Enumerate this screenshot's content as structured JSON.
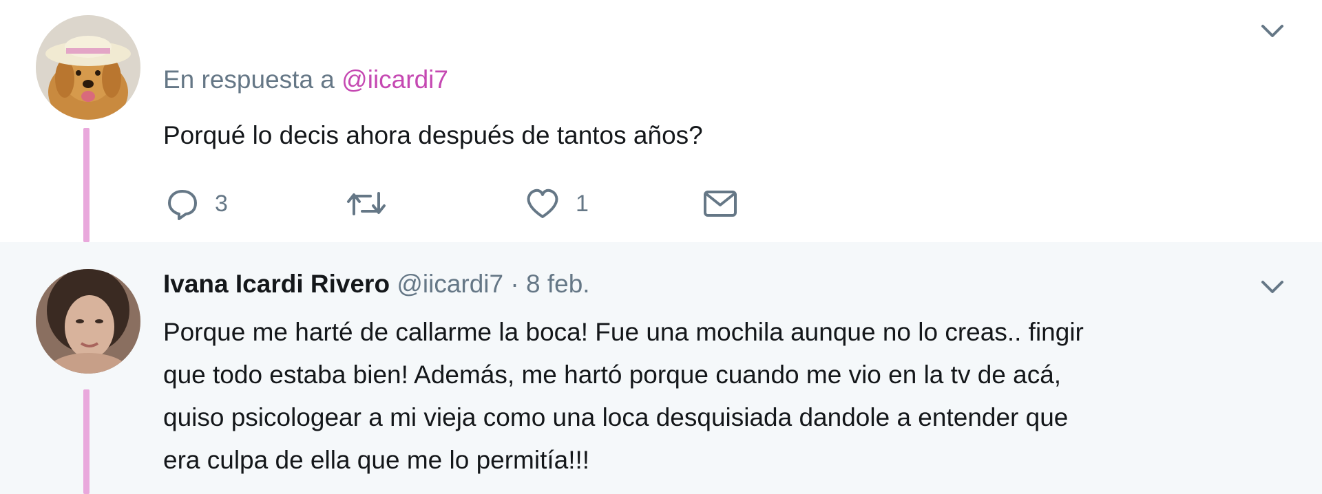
{
  "tweet1": {
    "reply_prefix": "En respuesta a",
    "reply_mention": "@iicardi7",
    "text": "Porqué lo decis ahora después de tantos años?",
    "actions": {
      "reply_count": "3",
      "retweet_count": "",
      "like_count": "1"
    }
  },
  "tweet2": {
    "name": "Ivana Icardi Rivero",
    "handle": "@iicardi7",
    "separator": "·",
    "date": "8 feb.",
    "lines": [
      "Porque me harté de callarme la boca! Fue una mochila aunque no lo creas.. fingir",
      "que todo estaba bien! Además, me hartó porque cuando me vio en la tv de acá,",
      "quiso psicologear a mi vieja como una loca desquisiada dandole a entender que",
      "era culpa de ella que me lo permitía!!!"
    ]
  },
  "icons": [
    "caret-down-icon",
    "reply-icon",
    "retweet-icon",
    "like-icon",
    "envelope-icon"
  ],
  "colors": {
    "thread_line": "#e9a8dc",
    "mention": "#c548b2",
    "muted": "#657786",
    "highlight_bg": "#f5f8fa"
  }
}
